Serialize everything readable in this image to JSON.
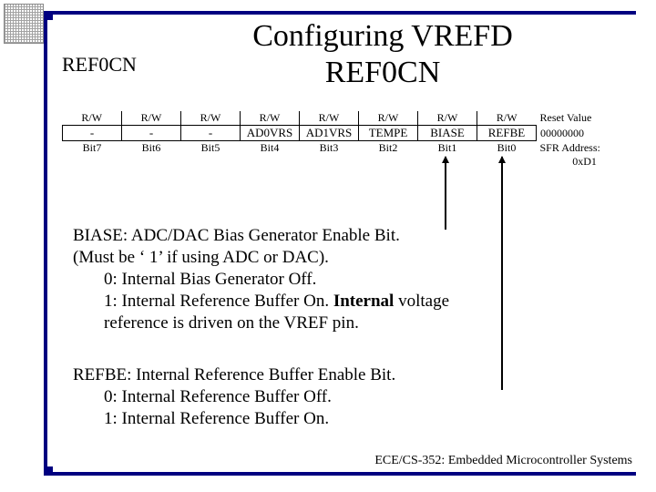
{
  "title": "Configuring VREFD REF0CN",
  "reg_label": "REF0CN",
  "table": {
    "rw": [
      "R/W",
      "R/W",
      "R/W",
      "R/W",
      "R/W",
      "R/W",
      "R/W",
      "R/W"
    ],
    "field": [
      "-",
      "-",
      "-",
      "AD0VRS",
      "AD1VRS",
      "TEMPE",
      "BIASE",
      "REFBE"
    ],
    "bit": [
      "Bit7",
      "Bit6",
      "Bit5",
      "Bit4",
      "Bit3",
      "Bit2",
      "Bit1",
      "Bit0"
    ],
    "reset_label": "Reset Value",
    "reset_value": "00000000",
    "addr_label": "SFR Address:",
    "addr_value": "0xD1"
  },
  "biase": {
    "h": "BIASE: ADC/DAC Bias Generator Enable Bit.",
    "note": "(Must be ‘ 1’ if using ADC or DAC).",
    "z": "0: Internal Bias Generator Off.",
    "o1": "1: Internal Reference Buffer On. ",
    "o1b": "Internal ",
    "o1c": "voltage",
    "o2": "reference is driven on the VREF pin."
  },
  "refbe": {
    "h": "REFBE: Internal Reference Buffer Enable Bit.",
    "z": "0: Internal Reference Buffer Off.",
    "o": "1: Internal Reference Buffer On."
  },
  "footer": "ECE/CS-352: Embedded Microcontroller Systems"
}
